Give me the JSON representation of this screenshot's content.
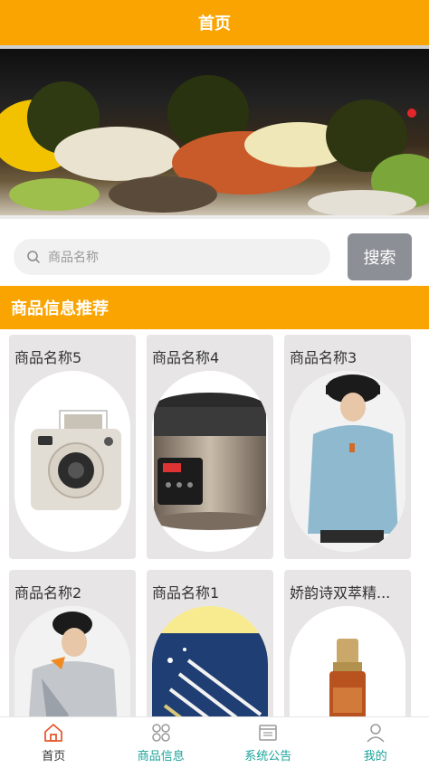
{
  "header": {
    "title": "首页"
  },
  "search": {
    "placeholder": "商品名称",
    "button_label": "搜索"
  },
  "section": {
    "title": "商品信息推荐"
  },
  "products": [
    {
      "name": "商品名称5",
      "image": "instant-camera"
    },
    {
      "name": "商品名称4",
      "image": "rice-cooker"
    },
    {
      "name": "商品名称3",
      "image": "person-blue-hoodie"
    },
    {
      "name": "商品名称2",
      "image": "person-silver-jacket"
    },
    {
      "name": "商品名称1",
      "image": "makeup-brushes"
    },
    {
      "name": "娇韵诗双萃精...",
      "image": "serum-bottle"
    }
  ],
  "tabbar": {
    "items": [
      {
        "label": "首页",
        "icon": "home-icon",
        "active": true
      },
      {
        "label": "商品信息",
        "icon": "grid-icon",
        "active": false
      },
      {
        "label": "系统公告",
        "icon": "notice-icon",
        "active": false
      },
      {
        "label": "我的",
        "icon": "user-icon",
        "active": false
      }
    ]
  },
  "colors": {
    "brand": "#f9a400",
    "tab_text": "#1aa39a",
    "search_button": "#8c9096"
  }
}
